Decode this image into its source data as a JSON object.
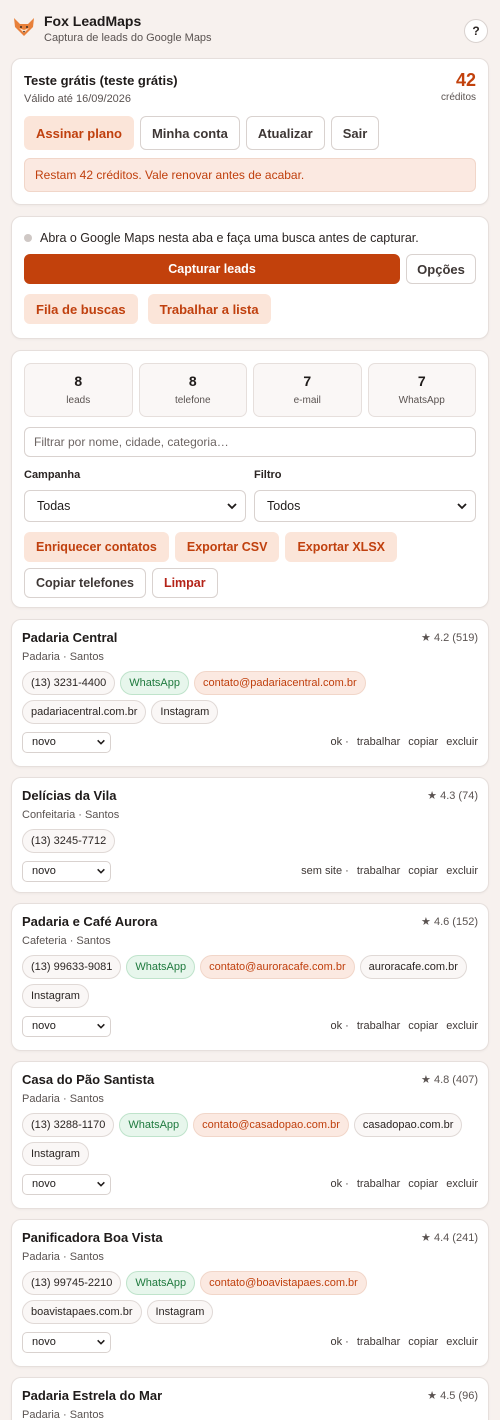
{
  "header": {
    "title": "Fox LeadMaps",
    "subtitle": "Captura de leads do Google Maps",
    "help_label": "?"
  },
  "plan": {
    "title": "Teste grátis (teste grátis)",
    "valid": "Válido até 16/09/2026",
    "credits_number": "42",
    "credits_label": "créditos",
    "buttons": {
      "subscribe": "Assinar plano",
      "account": "Minha conta",
      "refresh": "Atualizar",
      "logout": "Sair"
    },
    "notice": "Restam 42 créditos. Vale renovar antes de acabar."
  },
  "capture": {
    "hint": "Abra o Google Maps nesta aba e faça uma busca antes de capturar.",
    "capture_label": "Capturar leads",
    "options_label": "Opções",
    "queue_label": "Fila de buscas",
    "work_label": "Trabalhar a lista"
  },
  "stats": {
    "items": [
      {
        "value": "8",
        "label": "leads"
      },
      {
        "value": "8",
        "label": "telefone"
      },
      {
        "value": "7",
        "label": "e-mail"
      },
      {
        "value": "7",
        "label": "WhatsApp"
      }
    ],
    "filter_placeholder": "Filtrar por nome, cidade, categoria…",
    "campaign_label": "Campanha",
    "campaign_value": "Todas",
    "filter_label": "Filtro",
    "filter_value": "Todos",
    "actions": {
      "enrich": "Enriquecer contatos",
      "export_csv": "Exportar CSV",
      "export_xlsx": "Exportar XLSX",
      "copy_phones": "Copiar telefones",
      "clear": "Limpar"
    }
  },
  "leads": [
    {
      "name": "Padaria Central",
      "rating": "★ 4.2 (519)",
      "category": "Padaria · Santos",
      "phone": "(13) 3231-4400",
      "whatsapp": "WhatsApp",
      "email": "contato@padariacentral.com.br",
      "site": "padariacentral.com.br",
      "social": "Instagram",
      "status": "novo",
      "site_flag": "ok ·",
      "links": [
        "trabalhar",
        "copiar",
        "excluir"
      ]
    },
    {
      "name": "Delícias da Vila",
      "rating": "★ 4.3 (74)",
      "category": "Confeitaria · Santos",
      "phone": "(13) 3245-7712",
      "status": "novo",
      "site_flag": "sem site ·",
      "links": [
        "trabalhar",
        "copiar",
        "excluir"
      ]
    },
    {
      "name": "Padaria e Café Aurora",
      "rating": "★ 4.6 (152)",
      "category": "Cafeteria · Santos",
      "phone": "(13) 99633-9081",
      "whatsapp": "WhatsApp",
      "email": "contato@auroracafe.com.br",
      "site": "auroracafe.com.br",
      "social": "Instagram",
      "status": "novo",
      "site_flag": "ok ·",
      "links": [
        "trabalhar",
        "copiar",
        "excluir"
      ]
    },
    {
      "name": "Casa do Pão Santista",
      "rating": "★ 4.8 (407)",
      "category": "Padaria · Santos",
      "phone": "(13) 3288-1170",
      "whatsapp": "WhatsApp",
      "email": "contato@casadopao.com.br",
      "site": "casadopao.com.br",
      "social": "Instagram",
      "status": "novo",
      "site_flag": "ok ·",
      "links": [
        "trabalhar",
        "copiar",
        "excluir"
      ]
    },
    {
      "name": "Panificadora Boa Vista",
      "rating": "★ 4.4 (241)",
      "category": "Padaria · Santos",
      "phone": "(13) 99745-2210",
      "whatsapp": "WhatsApp",
      "email": "contato@boavistapaes.com.br",
      "site": "boavistapaes.com.br",
      "social": "Instagram",
      "status": "novo",
      "site_flag": "ok ·",
      "links": [
        "trabalhar",
        "copiar",
        "excluir"
      ]
    },
    {
      "name": "Padaria Estrela do Mar",
      "rating": "★ 4.5 (96)",
      "category": "Padaria · Santos"
    }
  ],
  "colors": {
    "accent": "#c2410c",
    "accent_soft": "#fbe5d9",
    "whatsapp": "#1f7a3e",
    "background": "#f7f1ee"
  }
}
